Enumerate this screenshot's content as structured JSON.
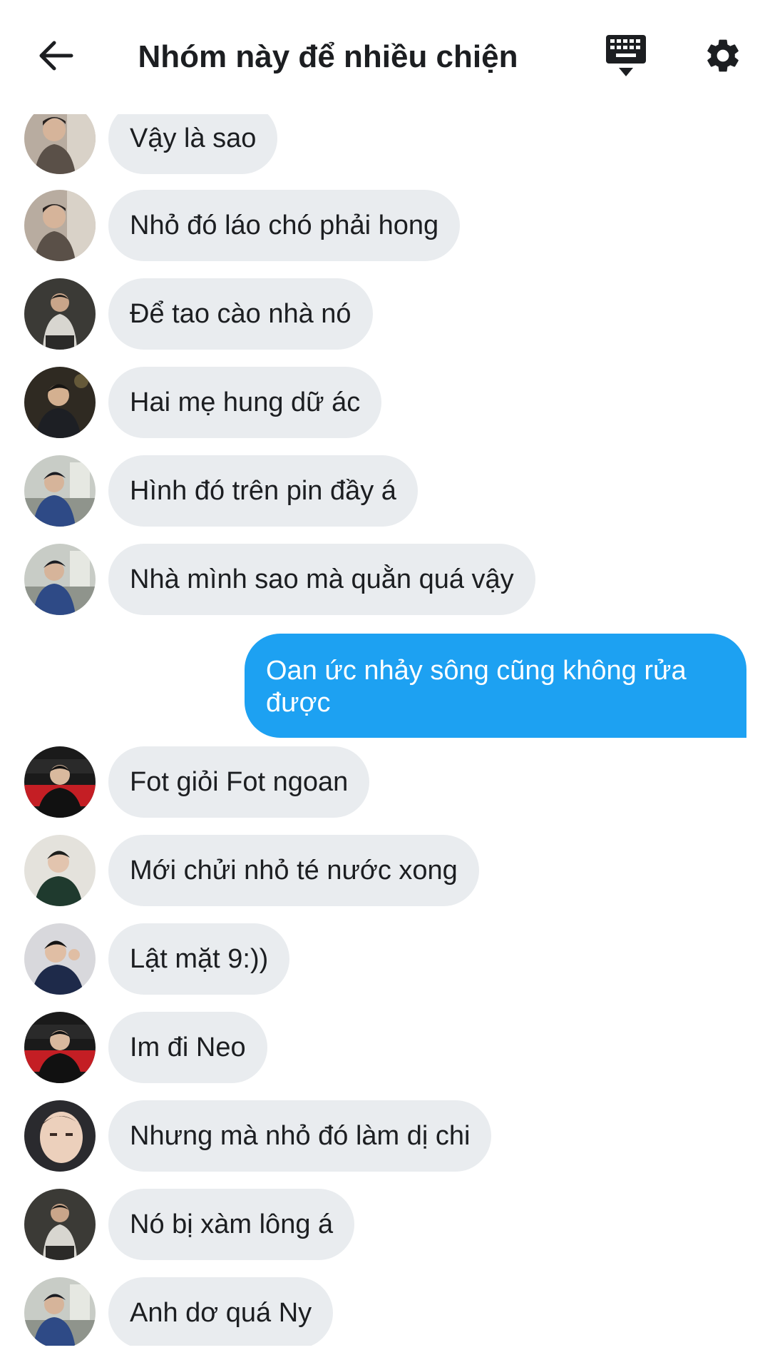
{
  "header": {
    "title": "Nhóm này để nhiều chiện",
    "back_icon": "arrow-left-icon",
    "keyboard_icon": "keyboard-icon",
    "settings_icon": "gear-icon"
  },
  "messages": [
    {
      "sender": "incoming",
      "text": "Vậy là sao"
    },
    {
      "sender": "incoming",
      "text": "Nhỏ đó láo chó phải hong"
    },
    {
      "sender": "incoming",
      "text": "Để tao cào nhà nó"
    },
    {
      "sender": "incoming",
      "text": "Hai mẹ hung dữ ác"
    },
    {
      "sender": "incoming",
      "text": "Hình đó trên pin đầy á"
    },
    {
      "sender": "incoming",
      "text": "Nhà mình sao mà quằn quá vậy"
    },
    {
      "sender": "outgoing",
      "text": "Oan ức nhảy sông cũng không rửa được"
    },
    {
      "sender": "incoming",
      "text": "Fot giỏi Fot ngoan"
    },
    {
      "sender": "incoming",
      "text": "Mới chửi nhỏ té nước xong"
    },
    {
      "sender": "incoming",
      "text": "Lật mặt 9:))"
    },
    {
      "sender": "incoming",
      "text": "Im đi Neo"
    },
    {
      "sender": "incoming",
      "text": "Nhưng mà nhỏ đó làm dị chi"
    },
    {
      "sender": "incoming",
      "text": "Nó bị xàm lông á"
    },
    {
      "sender": "incoming",
      "text": "Anh dơ quá Ny"
    }
  ],
  "colors": {
    "incoming_bubble": "#e9ecef",
    "outgoing_bubble": "#1da1f2",
    "text": "#1c1e21"
  }
}
